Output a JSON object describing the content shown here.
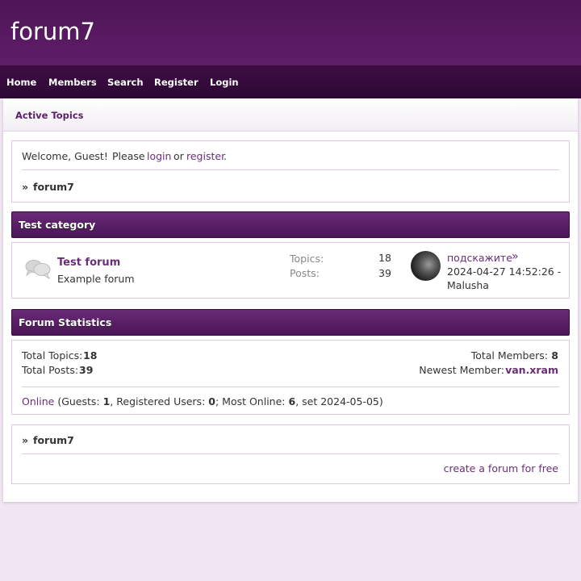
{
  "site": {
    "title": "forum7"
  },
  "nav": [
    {
      "label": "Home"
    },
    {
      "label": "Members"
    },
    {
      "label": "Search"
    },
    {
      "label": "Register"
    },
    {
      "label": "Login"
    }
  ],
  "subnav": {
    "active_topics": "Active Topics"
  },
  "welcome": {
    "greeting": "Welcome, Guest!",
    "please": "Please",
    "login": "login",
    "or": "or",
    "register": "register",
    "period": ".",
    "breadcrumb_sep": "»",
    "breadcrumb": "forum7"
  },
  "category": {
    "title": "Test category",
    "forum": {
      "name": "Test forum",
      "description": "Example forum",
      "topics_label": "Topics:",
      "topics_value": "18",
      "posts_label": "Posts:",
      "posts_value": "39",
      "last_post_title": "подскажите",
      "last_post_arrow": "»",
      "last_post_date": "2024-04-27 14:52:26 -",
      "last_post_user": "Malusha"
    }
  },
  "stats": {
    "title": "Forum Statistics",
    "total_topics_label": "Total Topics:",
    "total_topics": "18",
    "total_posts_label": "Total Posts:",
    "total_posts": "39",
    "total_members_label": "Total Members:",
    "total_members": "8",
    "newest_member_label": "Newest Member:",
    "newest_member": "van.xram",
    "online_link": "Online",
    "guests_label": "(Guests:",
    "guests": "1",
    "registered_label": ", Registered Users:",
    "registered": "0",
    "most_online_label": "; Most Online:",
    "most_online": "6",
    "most_online_date": ", set 2024-05-05)"
  },
  "footer": {
    "breadcrumb_sep": "»",
    "breadcrumb": "forum7",
    "create_link": "create a forum for free"
  }
}
